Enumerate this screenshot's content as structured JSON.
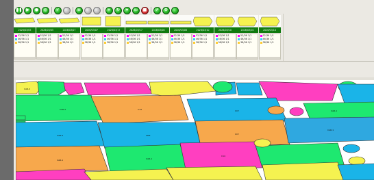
{
  "toolbar": {
    "buttons": [
      {
        "name": "pause-icon",
        "color": "green",
        "glyph": "❚❚"
      },
      {
        "name": "play-icon",
        "color": "green",
        "glyph": "▶"
      },
      {
        "name": "record-icon",
        "color": "green",
        "glyph": "●"
      },
      {
        "name": "settings-icon",
        "color": "green",
        "glyph": "◎"
      },
      {
        "name": "sep",
        "color": "sep"
      },
      {
        "name": "check-icon",
        "color": "green",
        "glyph": "✓"
      },
      {
        "name": "disabled-icon",
        "color": "gray",
        "glyph": ""
      },
      {
        "name": "sep",
        "color": "sep"
      },
      {
        "name": "layers-icon",
        "color": "green",
        "glyph": "≡"
      },
      {
        "name": "disabled-icon",
        "color": "gray",
        "glyph": ""
      },
      {
        "name": "disabled-icon",
        "color": "gray",
        "glyph": ""
      },
      {
        "name": "sep",
        "color": "sep"
      },
      {
        "name": "forward-icon",
        "color": "green",
        "glyph": "»"
      },
      {
        "name": "refresh-icon",
        "color": "green",
        "glyph": "↻"
      },
      {
        "name": "down-icon",
        "color": "green",
        "glyph": "▾"
      },
      {
        "name": "window-icon",
        "color": "green",
        "glyph": "▭"
      },
      {
        "name": "stop-icon",
        "color": "red",
        "glyph": "■"
      },
      {
        "name": "sep",
        "color": "sep"
      },
      {
        "name": "export-icon",
        "color": "green",
        "glyph": "↗"
      },
      {
        "name": "options-icon",
        "color": "green",
        "glyph": "⚙"
      },
      {
        "name": "circle-icon",
        "color": "green",
        "glyph": ""
      }
    ]
  },
  "markers": {
    "headers": [
      "2026/03/05",
      "2026/03/05",
      "2026/03/07",
      "2026/03/07",
      "2026/03/17",
      "2026/03/17",
      "2026/03/08",
      "2026/03/08",
      "2026/03/10",
      "2026/03/10",
      "2026/03/10",
      "2026/03/10"
    ],
    "stat_rows": [
      {
        "label": "52/36 1/1",
        "color": "#ff00ff"
      },
      {
        "label": "46/36 1/1",
        "color": "#33ccff"
      },
      {
        "label": "38/36 1/1",
        "color": "#ffcc33"
      }
    ],
    "thumb_shapes": [
      "strip",
      "strip",
      "strip",
      "rect",
      "sq",
      "bar",
      "bar",
      "bar",
      "blob",
      "blob",
      "blob",
      "blob"
    ]
  },
  "colors": {
    "header_green": "#0f7a0f",
    "piece_pink": "#ff3fc0",
    "piece_cyan": "#1ab4e8",
    "piece_orange": "#f7a84c",
    "piece_green": "#1ee870",
    "piece_yellow": "#f5f250",
    "piece_blue": "#2fa8e0"
  },
  "canvas": {
    "piece_labels": [
      "CAR-2",
      "CAR-2",
      "C14",
      "CCY",
      "CAR-1",
      "CAR-2",
      "CDR",
      "CCY",
      "CAR-1",
      "CAR-1",
      "CAR-1",
      "C14"
    ]
  }
}
